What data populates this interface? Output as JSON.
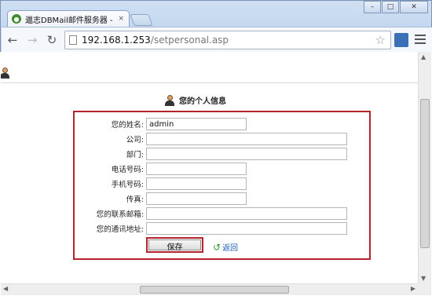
{
  "browser": {
    "tab_title": "邋志DBMail邮件服务器 - V",
    "tab_close": "×",
    "url_host": "192.168.1.253",
    "url_path": "/setpersonal.asp"
  },
  "page": {
    "title": "您的个人信息",
    "fields": [
      {
        "label": "您的姓名:",
        "value": "admin",
        "size": "short"
      },
      {
        "label": "公司:",
        "value": "",
        "size": "long"
      },
      {
        "label": "部门:",
        "value": "",
        "size": "long"
      },
      {
        "label": "电话号码:",
        "value": "",
        "size": "short"
      },
      {
        "label": "手机号码:",
        "value": "",
        "size": "short"
      },
      {
        "label": "传真:",
        "value": "",
        "size": "short"
      },
      {
        "label": "您的联系邮箱:",
        "value": "",
        "size": "long"
      },
      {
        "label": "您的通讯地址:",
        "value": "",
        "size": "long"
      }
    ],
    "save_label": "保存",
    "back_label": "返回"
  },
  "colors": {
    "accent_border": "#b3242b",
    "link": "#1a5fb4"
  },
  "icons": {
    "favicon": "dbmail-favicon",
    "user": "person-icon",
    "back": "green-return-arrow-icon"
  }
}
